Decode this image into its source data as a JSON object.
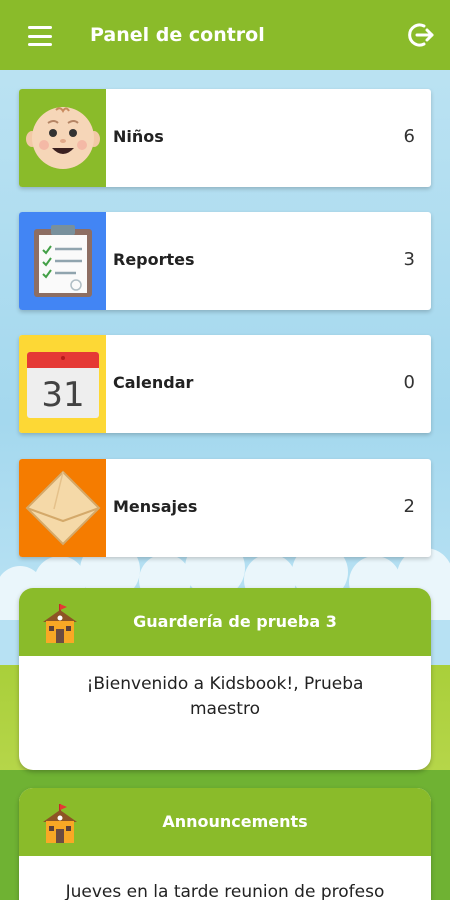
{
  "header": {
    "title": "Panel de control",
    "menu_icon": "hamburger-menu-icon",
    "logout_icon": "logout-icon"
  },
  "cards": [
    {
      "label": "Niños",
      "count": "6",
      "icon": "baby-face-icon",
      "color": "#8abb2a"
    },
    {
      "label": "Reportes",
      "count": "3",
      "icon": "clipboard-icon",
      "color": "#4285f4"
    },
    {
      "label": "Calendar",
      "count": "0",
      "icon": "calendar-icon",
      "color": "#fdd835"
    },
    {
      "label": "Mensajes",
      "count": "2",
      "icon": "envelope-icon",
      "color": "#f57c00"
    }
  ],
  "calendar_day": "31",
  "panels": [
    {
      "title": "Guardería de prueba 3",
      "body": "¡Bienvenido a Kidsbook!, Prueba maestro"
    },
    {
      "title": "Announcements",
      "body": "Jueves en la tarde reunion de profeso"
    }
  ],
  "colors": {
    "header": "#8abb2a",
    "accent_green": "#8abb2a"
  }
}
